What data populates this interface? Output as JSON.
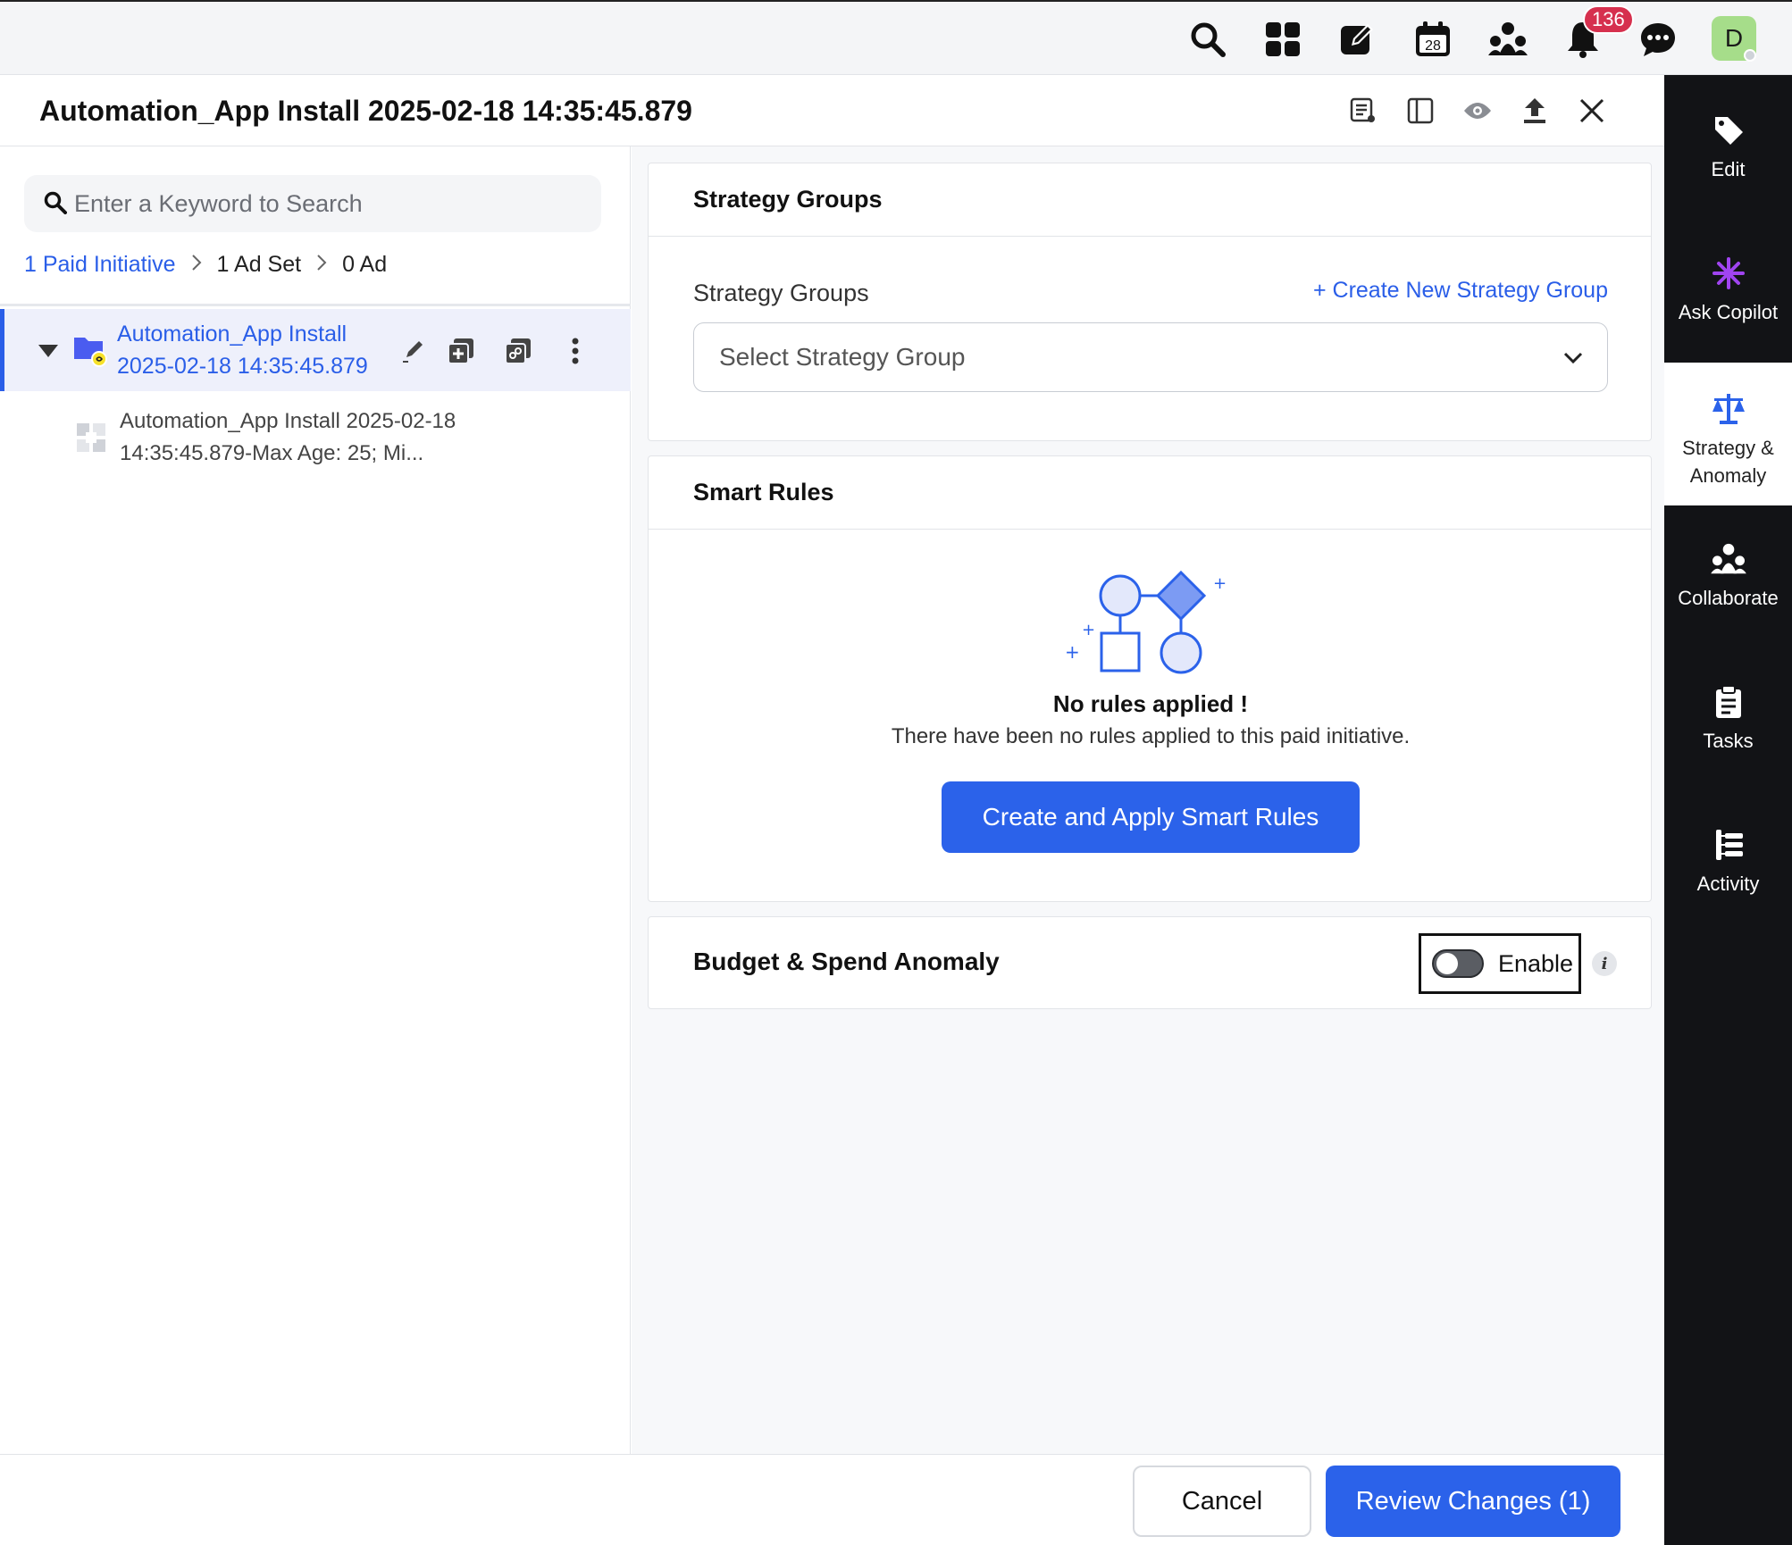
{
  "topbar": {
    "icons": [
      "search-icon",
      "apps-grid-icon",
      "compose-icon",
      "calendar-icon",
      "collaborate-icon",
      "notification-bell-icon",
      "chat-icon"
    ],
    "calendar_day": "28",
    "notification_count": "136",
    "avatar_initial": "D"
  },
  "header": {
    "title": "Automation_App Install 2025-02-18 14:35:45.879",
    "tools": [
      "list-settings-icon",
      "panel-layout-icon",
      "preview-eye-icon",
      "upload-icon",
      "close-icon"
    ]
  },
  "rail": {
    "items": [
      {
        "label": "Edit",
        "icon": "tag-icon",
        "active": false
      },
      {
        "label": "Ask Copilot",
        "icon": "copilot-sparkle-icon",
        "active": false
      },
      {
        "label": "Strategy & Anomaly",
        "icon": "balance-scale-icon",
        "active": true
      },
      {
        "label": "Collaborate",
        "icon": "collaborate-icon",
        "active": false
      },
      {
        "label": "Tasks",
        "icon": "clipboard-icon",
        "active": false
      },
      {
        "label": "Activity",
        "icon": "activity-tree-icon",
        "active": false
      }
    ]
  },
  "left": {
    "search_placeholder": "Enter a Keyword to Search",
    "breadcrumb": {
      "initiative": "1 Paid Initiative",
      "adset": "1 Ad Set",
      "ad": "0 Ad"
    },
    "tree": {
      "selected_title": "Automation_App Install 2025-02-18 14:35:45.879",
      "child_title": "Automation_App Install 2025-02-18 14:35:45.879-Max Age: 25; Mi..."
    }
  },
  "main": {
    "strategy": {
      "heading": "Strategy Groups",
      "field_label": "Strategy Groups",
      "create_link": "+ Create New Strategy Group",
      "select_placeholder": "Select Strategy Group"
    },
    "smart_rules": {
      "heading": "Smart Rules",
      "empty_title": "No rules applied !",
      "empty_text": "There have been no rules applied to this paid initiative.",
      "button": "Create and Apply Smart Rules"
    },
    "budget": {
      "heading": "Budget & Spend Anomaly",
      "toggle_label": "Enable",
      "toggle_on": false,
      "info": "i"
    }
  },
  "footer": {
    "cancel": "Cancel",
    "review": "Review Changes (1)"
  },
  "colors": {
    "accent": "#2b62ea",
    "badge": "#d6304e",
    "rail_bg": "#121316",
    "copilot": "#a044f0"
  }
}
